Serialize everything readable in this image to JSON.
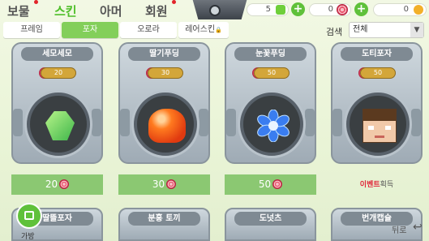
{
  "main_tabs": [
    {
      "label": "보물",
      "active": false,
      "dot": true
    },
    {
      "label": "스킨",
      "active": true,
      "dot": false
    },
    {
      "label": "아머",
      "active": false,
      "dot": false
    },
    {
      "label": "회원",
      "active": false,
      "dot": true
    }
  ],
  "currency": [
    {
      "value": "5",
      "icon": "green-gem-icon",
      "color": "#6fcf3b"
    },
    {
      "value": "0",
      "icon": "candy-icon",
      "color": "#e8556c"
    },
    {
      "value": "0",
      "icon": "coin-icon",
      "color": "#f2b02a"
    }
  ],
  "sub_tabs": [
    {
      "label": "프레임",
      "active": false
    },
    {
      "label": "포자",
      "active": true
    },
    {
      "label": "오로라",
      "active": false
    },
    {
      "label": "레어스킨",
      "active": false,
      "locked": true
    }
  ],
  "search": {
    "label": "검색",
    "selected": "전체"
  },
  "cards": [
    {
      "title": "세모세모",
      "price": "20",
      "buy_label": "20",
      "icon": "green-gem-icon"
    },
    {
      "title": "딸기푸딩",
      "price": "30",
      "buy_label": "30",
      "icon": "strawberry-pudding-icon"
    },
    {
      "title": "눈꽃푸딩",
      "price": "50",
      "buy_label": "50",
      "icon": "snowflake-icon"
    },
    {
      "title": "도티포자",
      "price": "50",
      "event_label": "이벤트",
      "event_suffix": "획득",
      "icon": "doti-face-icon"
    }
  ],
  "bottom_cards": [
    "딸뜰포자",
    "분홍 토끼",
    "도넛츠",
    "번개캡슐"
  ],
  "bag_label": "가방",
  "back_label": "뒤로"
}
